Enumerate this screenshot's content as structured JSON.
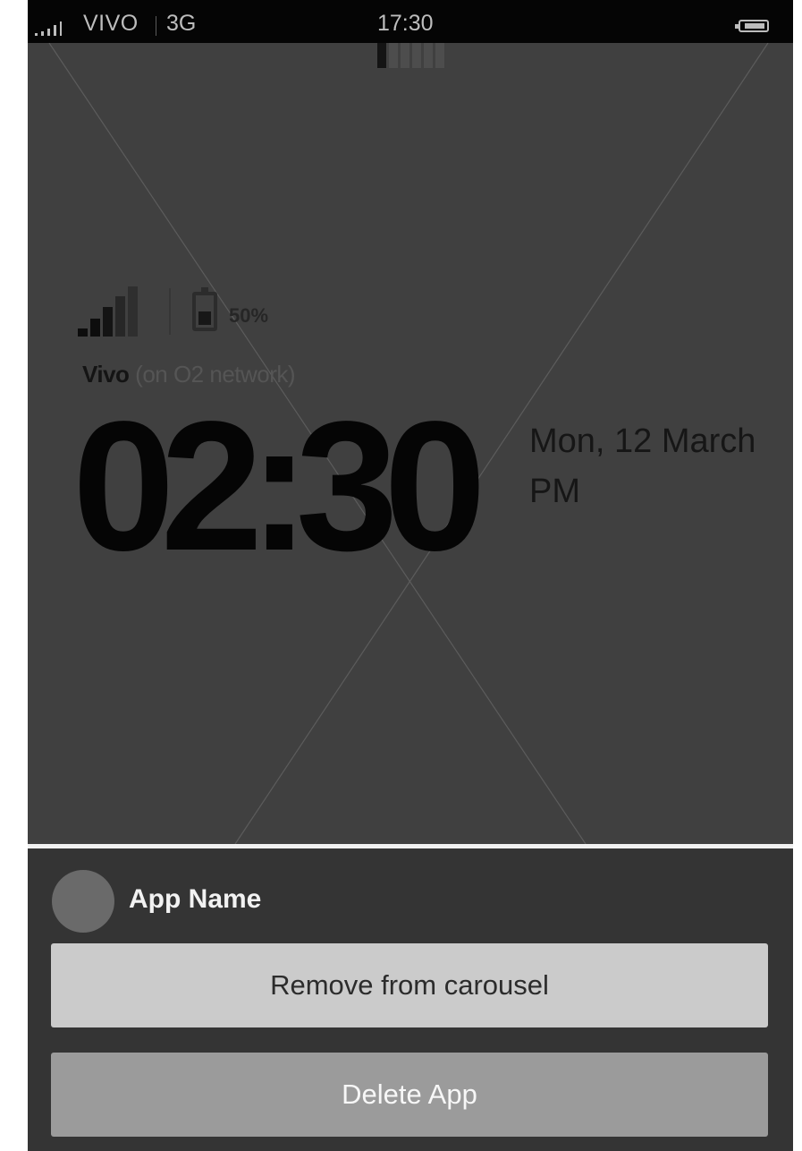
{
  "status_bar": {
    "carrier": "VIVO",
    "network": "3G",
    "time": "17:30",
    "icons": [
      "signal-icon",
      "battery-icon"
    ]
  },
  "lockscreen": {
    "battery_percent": "50%",
    "carrier_name": "Vivo",
    "carrier_sub": " (on O2 network)",
    "clock": "02:30",
    "date": "Mon, 12 March",
    "ampm": "PM",
    "page_indicator": {
      "count": 6,
      "active_index": 0
    }
  },
  "action_sheet": {
    "app_name": "App Name",
    "remove_label": "Remove from carousel",
    "delete_label": "Delete App"
  },
  "colors": {
    "background": "#404040",
    "status_bar": "#050505",
    "sheet": "#343434",
    "remove_button": "#cbcbcb",
    "delete_button": "#9b9b9b"
  }
}
